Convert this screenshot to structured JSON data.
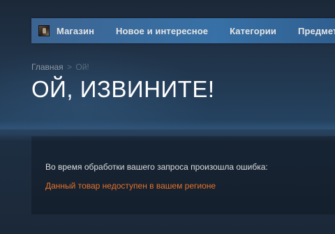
{
  "navbar": {
    "avatar_icon": "user-avatar-icon",
    "items": [
      {
        "label": "Магазин"
      },
      {
        "label": "Новое и интересное"
      },
      {
        "label": "Категории"
      },
      {
        "label": "Предмет"
      }
    ]
  },
  "breadcrumbs": {
    "home": "Главная",
    "separator": ">",
    "current": "Ой!"
  },
  "page": {
    "title": "ОЙ, ИЗВИНИТЕ!"
  },
  "error": {
    "message": "Во время обработки вашего запроса произошла ошибка:",
    "detail": "Данный товар недоступен в вашем регионе"
  },
  "colors": {
    "background": "#1b2838",
    "nav": "#3a78b1",
    "error_detail": "#e6722a"
  }
}
